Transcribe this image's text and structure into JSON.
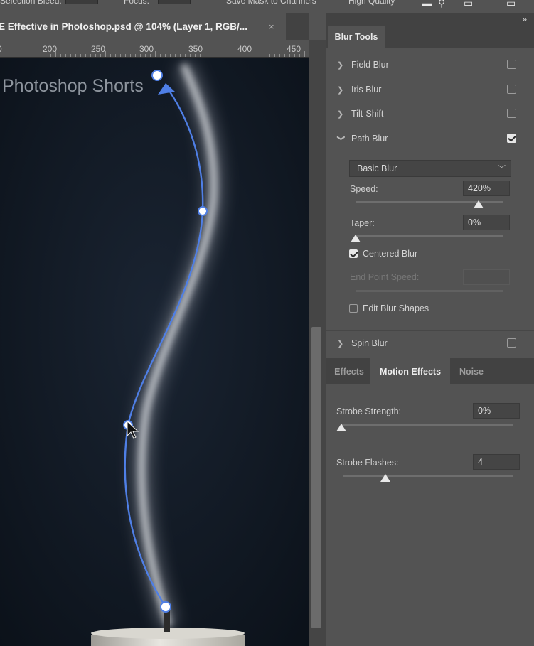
{
  "topbar": {
    "left_label": "Selection Bleed:",
    "mid_label": "Focus:",
    "save_label": "Save Mask to Channels",
    "hq_label": "High Quality"
  },
  "document": {
    "tab_title": "E Effective in Photoshop.psd @ 104% (Layer 1, RGB/...",
    "close_glyph": "×"
  },
  "ruler": {
    "labels": [
      "0",
      "200",
      "250",
      "300",
      "350",
      "400",
      "450"
    ]
  },
  "canvas": {
    "watermark": "Photoshop Shorts",
    "background": "#101822",
    "path_color": "#4f7fe6"
  },
  "panel": {
    "collapse_glyph": "»",
    "title_tab": "Blur Tools",
    "blur_tools": [
      {
        "label": "Field Blur",
        "checked": false,
        "expanded": false
      },
      {
        "label": "Iris Blur",
        "checked": false,
        "expanded": false
      },
      {
        "label": "Tilt-Shift",
        "checked": false,
        "expanded": false
      },
      {
        "label": "Path Blur",
        "checked": true,
        "expanded": true
      },
      {
        "label": "Spin Blur",
        "checked": false,
        "expanded": false
      }
    ],
    "path_blur": {
      "mode": "Basic Blur",
      "speed_label": "Speed:",
      "speed_value": "420%",
      "speed_fraction": 0.83,
      "taper_label": "Taper:",
      "taper_value": "0%",
      "taper_fraction": 0.0,
      "centered_label": "Centered Blur",
      "centered_checked": true,
      "end_speed_label": "End Point Speed:",
      "edit_shapes_label": "Edit Blur Shapes",
      "edit_shapes_checked": false
    },
    "effects_tabs": [
      "Effects",
      "Motion Effects",
      "Noise"
    ],
    "active_effects_tab": "Motion Effects",
    "motion_effects": {
      "strobe_strength_label": "Strobe Strength:",
      "strobe_strength_value": "0%",
      "strobe_strength_fraction": 0.0,
      "strobe_flashes_label": "Strobe Flashes:",
      "strobe_flashes_value": "4",
      "strobe_flashes_fraction": 0.25
    }
  }
}
